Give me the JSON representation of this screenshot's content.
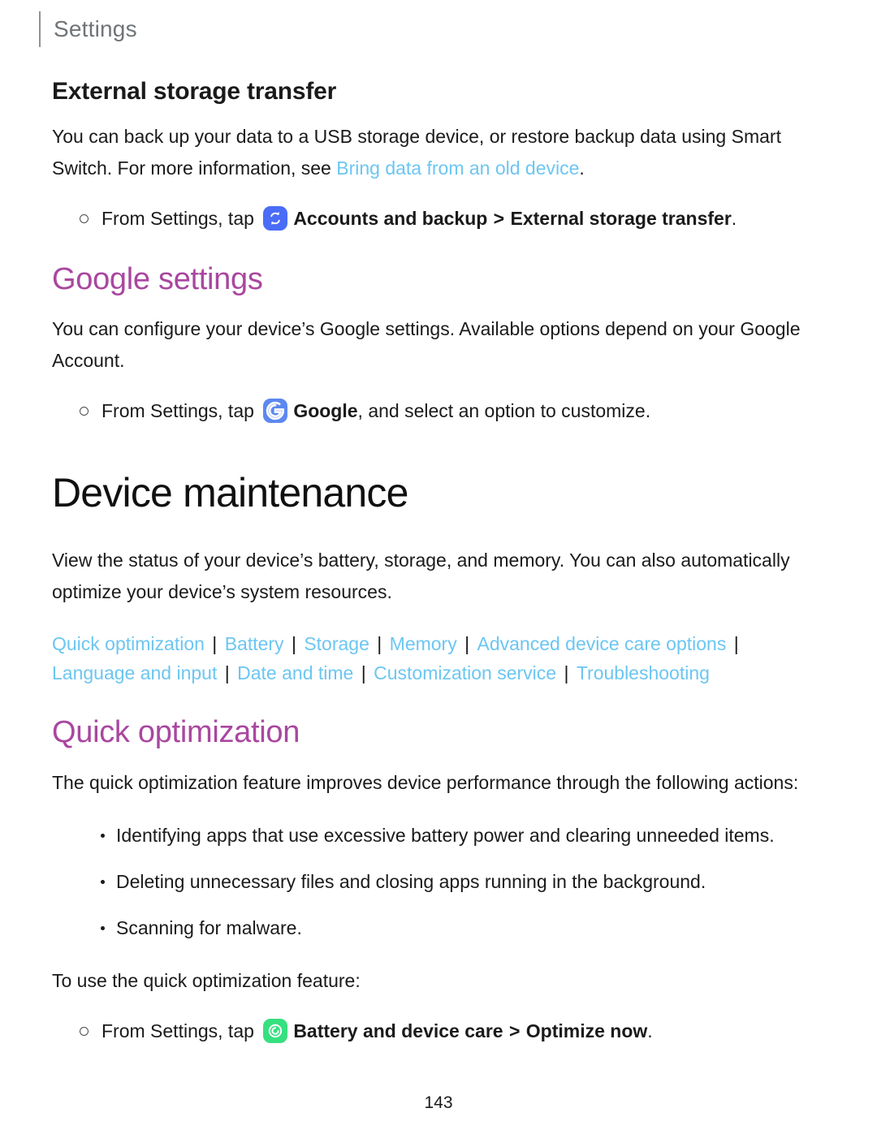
{
  "header": {
    "title": "Settings"
  },
  "sections": {
    "external_storage": {
      "heading": "External storage transfer",
      "paragraph_before_link": "You can back up your data to a USB storage device, or restore backup data using Smart Switch. For more information, see ",
      "link_label": "Bring data from an old device",
      "paragraph_after_link": ".",
      "instruction": {
        "prefix": "From Settings, tap ",
        "icon_name": "accounts-and-backup-icon",
        "icon_color": "#4a6cf7",
        "bold_1": "Accounts and backup",
        "arrow": " > ",
        "bold_2": "External storage transfer",
        "suffix": "."
      }
    },
    "google_settings": {
      "heading": "Google settings",
      "paragraph": "You can configure your device’s Google settings. Available options depend on your Google Account.",
      "instruction": {
        "prefix": "From Settings, tap ",
        "icon_name": "google-icon",
        "icon_color": "#5c88f0",
        "bold_1": "Google",
        "suffix": ", and select an option to customize."
      }
    },
    "device_maintenance": {
      "heading": "Device maintenance",
      "paragraph": "View the status of your device’s battery, storage, and memory. You can also automatically optimize your device’s system resources.",
      "nav_links": [
        "Quick optimization",
        "Battery",
        "Storage",
        "Memory",
        "Advanced device care options",
        "Language and input",
        "Date and time",
        "Customization service",
        "Troubleshooting"
      ],
      "nav_separator": "|"
    },
    "quick_optimization": {
      "heading": "Quick optimization",
      "paragraph": "The quick optimization feature improves device performance through the following actions:",
      "bullets": [
        "Identifying apps that use excessive battery power and clearing unneeded items.",
        "Deleting unnecessary files and closing apps running in the background.",
        "Scanning for malware."
      ],
      "lead_in": "To use the quick optimization feature:",
      "instruction": {
        "prefix": "From Settings, tap ",
        "icon_name": "battery-and-device-care-icon",
        "icon_color": "#36e07f",
        "bold_1": "Battery and device care",
        "arrow": " > ",
        "bold_2": "Optimize now",
        "suffix": "."
      }
    }
  },
  "footer": {
    "page_number": "143"
  },
  "colors": {
    "purple_heading": "#a9479f",
    "link_blue": "#6cc6f2",
    "header_gray": "#6f7478"
  }
}
